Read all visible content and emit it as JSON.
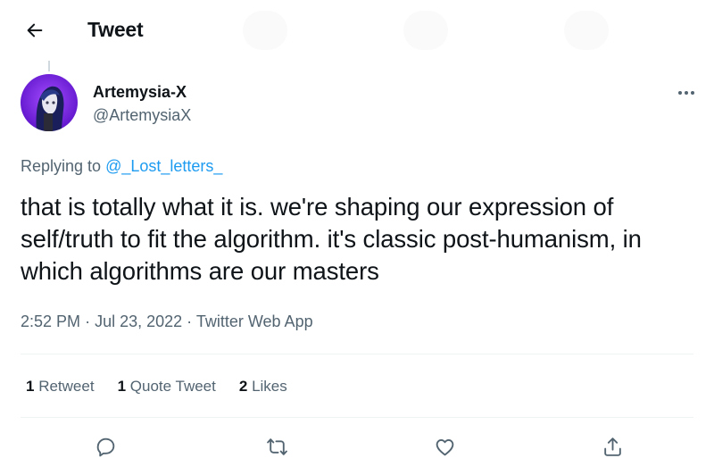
{
  "header": {
    "title": "Tweet",
    "back_icon": "arrow-left-icon"
  },
  "tweet": {
    "author": {
      "display_name": "Artemysia-X",
      "handle": "@ArtemysiaX",
      "avatar_color": "#7b2ff7"
    },
    "replying_to_prefix": "Replying to ",
    "replying_to_handle": "@_Lost_letters_",
    "text": "that is totally what it is. we're shaping our expression of self/truth to fit the algorithm. it's classic post-humanism, in which algorithms are our masters",
    "time": "2:52 PM",
    "separator": "·",
    "date": "Jul 23, 2022",
    "source": "Twitter Web App",
    "stats": {
      "retweets_count": "1",
      "retweets_label": "Retweet",
      "quotes_count": "1",
      "quotes_label": "Quote Tweet",
      "likes_count": "2",
      "likes_label": "Likes"
    },
    "actions": [
      "reply-icon",
      "retweet-icon",
      "like-icon",
      "share-icon"
    ]
  },
  "colors": {
    "link": "#1d9bf0",
    "text": "#0f1419",
    "secondary": "#536471",
    "divider": "#eff3f4"
  }
}
